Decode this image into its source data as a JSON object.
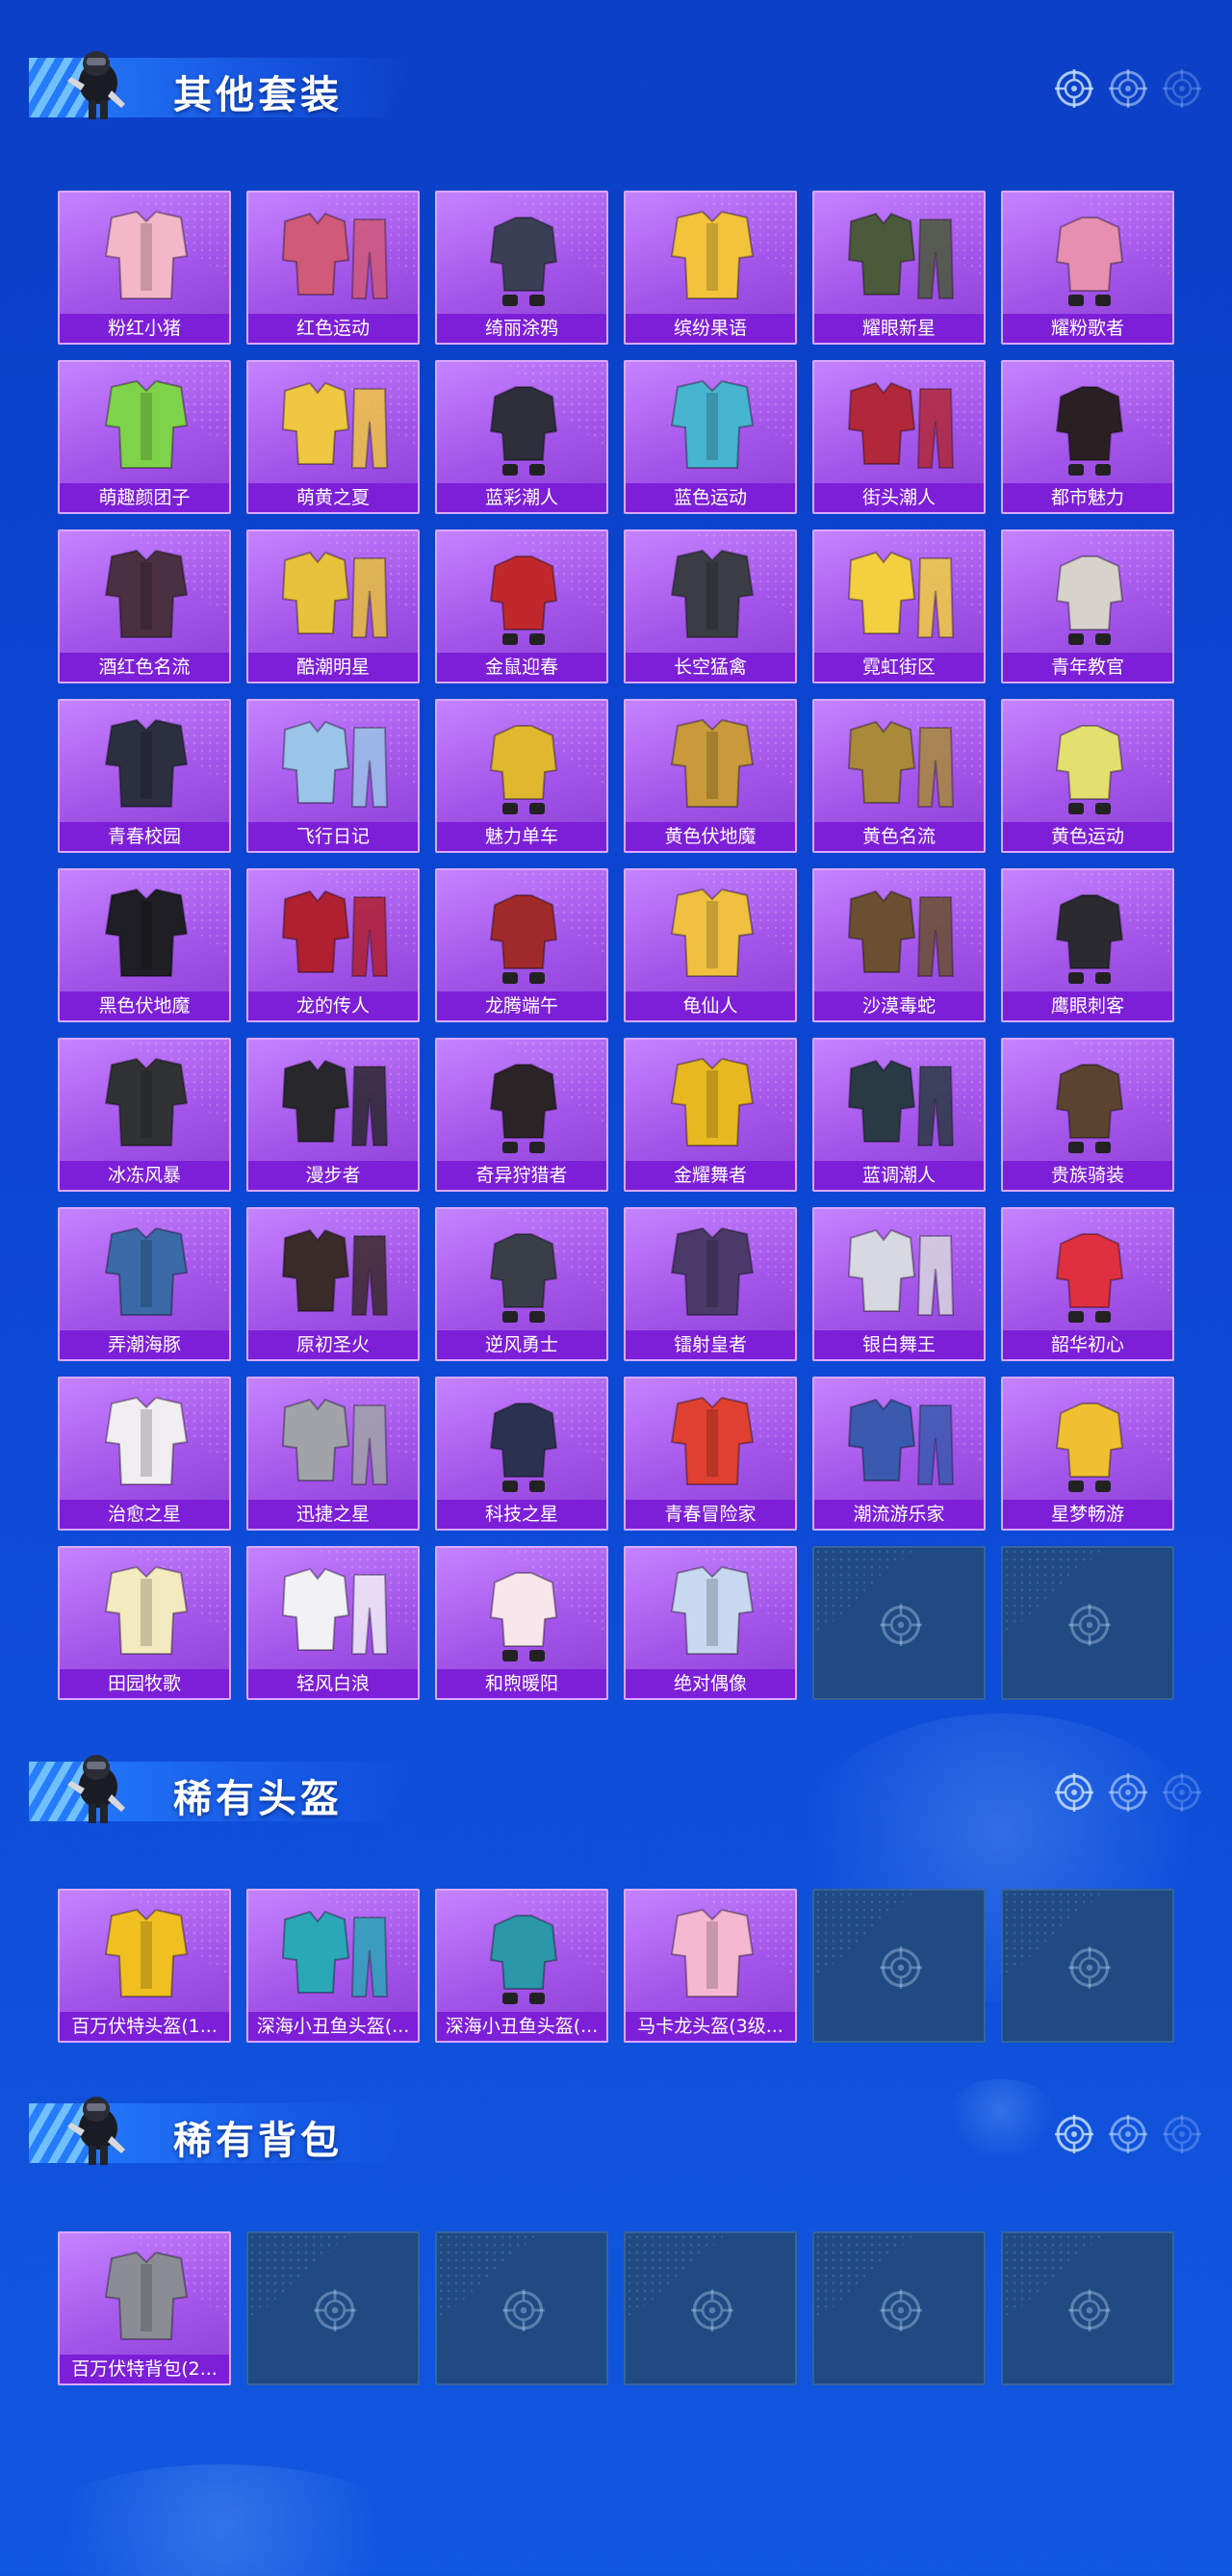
{
  "sections": [
    {
      "title": "其他套装",
      "items": [
        {
          "label": "粉红小猪",
          "tone": "#f3b7c8",
          "empty": false
        },
        {
          "label": "红色运动",
          "tone": "#d05a78",
          "empty": false
        },
        {
          "label": "绮丽涂鸦",
          "tone": "#3a3f55",
          "empty": false
        },
        {
          "label": "缤纷果语",
          "tone": "#f2c33b",
          "empty": false
        },
        {
          "label": "耀眼新星",
          "tone": "#4a5a3a",
          "empty": false
        },
        {
          "label": "耀粉歌者",
          "tone": "#e78fb0",
          "empty": false
        },
        {
          "label": "萌趣颜团子",
          "tone": "#7fd34a",
          "empty": false
        },
        {
          "label": "萌黄之夏",
          "tone": "#f0c740",
          "empty": false
        },
        {
          "label": "蓝彩潮人",
          "tone": "#2c2f3a",
          "empty": false
        },
        {
          "label": "蓝色运动",
          "tone": "#47b4d0",
          "empty": false
        },
        {
          "label": "街头潮人",
          "tone": "#b2283a",
          "empty": false
        },
        {
          "label": "都市魅力",
          "tone": "#2a2024",
          "empty": false
        },
        {
          "label": "酒红色名流",
          "tone": "#4a3040",
          "empty": false
        },
        {
          "label": "酷潮明星",
          "tone": "#e8c23a",
          "empty": false
        },
        {
          "label": "金鼠迎春",
          "tone": "#c0282c",
          "empty": false
        },
        {
          "label": "长空猛禽",
          "tone": "#3a3e44",
          "empty": false
        },
        {
          "label": "霓虹街区",
          "tone": "#f4d040",
          "empty": false
        },
        {
          "label": "青年教官",
          "tone": "#d8d2cc",
          "empty": false
        },
        {
          "label": "青春校园",
          "tone": "#2c2f40",
          "empty": false
        },
        {
          "label": "飞行日记",
          "tone": "#9ac4e8",
          "empty": false
        },
        {
          "label": "魅力单车",
          "tone": "#e0b830",
          "empty": false
        },
        {
          "label": "黄色伏地魔",
          "tone": "#c89a3a",
          "empty": false
        },
        {
          "label": "黄色名流",
          "tone": "#a88a3a",
          "empty": false
        },
        {
          "label": "黄色运动",
          "tone": "#e4e070",
          "empty": false
        },
        {
          "label": "黑色伏地魔",
          "tone": "#1e1e24",
          "empty": false
        },
        {
          "label": "龙的传人",
          "tone": "#b02030",
          "empty": false
        },
        {
          "label": "龙腾端午",
          "tone": "#a02a2a",
          "empty": false
        },
        {
          "label": "龟仙人",
          "tone": "#f0c040",
          "empty": false
        },
        {
          "label": "沙漠毒蛇",
          "tone": "#6a5030",
          "empty": false
        },
        {
          "label": "鹰眼刺客",
          "tone": "#2a2a30",
          "empty": false
        },
        {
          "label": "冰冻风暴",
          "tone": "#303234",
          "empty": false
        },
        {
          "label": "漫步者",
          "tone": "#28282c",
          "empty": false
        },
        {
          "label": "奇异狩猎者",
          "tone": "#2a2426",
          "empty": false
        },
        {
          "label": "金耀舞者",
          "tone": "#e8b820",
          "empty": false
        },
        {
          "label": "蓝调潮人",
          "tone": "#2a3a44",
          "empty": false
        },
        {
          "label": "贵族骑装",
          "tone": "#5a4430",
          "empty": false
        },
        {
          "label": "弄潮海豚",
          "tone": "#3a6aa8",
          "empty": false
        },
        {
          "label": "原初圣火",
          "tone": "#3a2a2a",
          "empty": false
        },
        {
          "label": "逆风勇士",
          "tone": "#3a3e48",
          "empty": false
        },
        {
          "label": "镭射皇者",
          "tone": "#4a3a6a",
          "empty": false
        },
        {
          "label": "银白舞王",
          "tone": "#d8d8e0",
          "empty": false
        },
        {
          "label": "韶华初心",
          "tone": "#e03040",
          "empty": false
        },
        {
          "label": "治愈之星",
          "tone": "#f0eef0",
          "empty": false
        },
        {
          "label": "迅捷之星",
          "tone": "#a0a4a8",
          "empty": false
        },
        {
          "label": "科技之星",
          "tone": "#2a3250",
          "empty": false
        },
        {
          "label": "青春冒险家",
          "tone": "#e04030",
          "empty": false
        },
        {
          "label": "潮流游乐家",
          "tone": "#3a5ab0",
          "empty": false
        },
        {
          "label": "星梦畅游",
          "tone": "#f0c030",
          "empty": false
        },
        {
          "label": "田园牧歌",
          "tone": "#f4eac0",
          "empty": false
        },
        {
          "label": "轻风白浪",
          "tone": "#f2f2f6",
          "empty": false
        },
        {
          "label": "和煦暖阳",
          "tone": "#f8e6ec",
          "empty": false
        },
        {
          "label": "绝对偶像",
          "tone": "#c8d8f0",
          "empty": false
        },
        {
          "label": "",
          "tone": "",
          "empty": true
        },
        {
          "label": "",
          "tone": "",
          "empty": true
        }
      ]
    },
    {
      "title": "稀有头盔",
      "items": [
        {
          "label": "百万伏特头盔(1...",
          "tone": "#f0c020",
          "empty": false
        },
        {
          "label": "深海小丑鱼头盔(...",
          "tone": "#2aa8b8",
          "empty": false
        },
        {
          "label": "深海小丑鱼头盔(...",
          "tone": "#2a98a8",
          "empty": false
        },
        {
          "label": "马卡龙头盔(3级...",
          "tone": "#f4b8d0",
          "empty": false
        },
        {
          "label": "",
          "tone": "",
          "empty": true
        },
        {
          "label": "",
          "tone": "",
          "empty": true
        }
      ]
    },
    {
      "title": "稀有背包",
      "items": [
        {
          "label": "百万伏特背包(2...",
          "tone": "#8a8e94",
          "empty": false
        },
        {
          "label": "",
          "tone": "",
          "empty": true
        },
        {
          "label": "",
          "tone": "",
          "empty": true
        },
        {
          "label": "",
          "tone": "",
          "empty": true
        },
        {
          "label": "",
          "tone": "",
          "empty": true
        },
        {
          "label": "",
          "tone": "",
          "empty": true
        }
      ]
    }
  ],
  "icons": {
    "header_decoration": "target-icon",
    "header_avatar": "character-avatar-icon",
    "empty_slot": "target-icon"
  },
  "colors": {
    "card_bg": "#a455e9",
    "card_label_bg": "#7d1fd8",
    "empty_bg": "#1f4a82",
    "page_bg": "#0b47d4"
  }
}
